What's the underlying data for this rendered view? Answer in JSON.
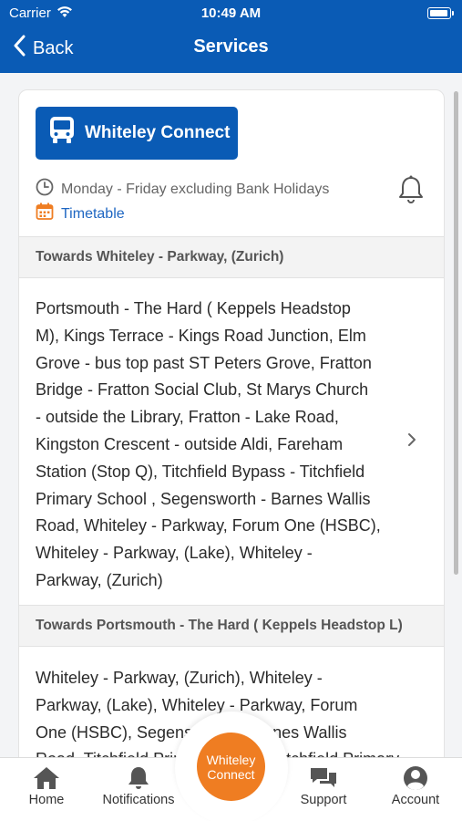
{
  "status_bar": {
    "carrier": "Carrier",
    "time": "10:49 AM"
  },
  "nav": {
    "back_label": "Back",
    "title": "Services"
  },
  "service": {
    "route_name": "Whiteley Connect",
    "schedule": "Monday - Friday excluding Bank Holidays",
    "timetable_label": "Timetable"
  },
  "directions": [
    {
      "heading": "Towards Whiteley - Parkway, (Zurich)",
      "stops_lines": [
        "Portsmouth - The Hard ( Keppels Headstop",
        "M), Kings Terrace - Kings Road Junction, Elm",
        "Grove - bus top past ST Peters Grove, Fratton",
        "Bridge - Fratton Social Club, St Marys Church",
        "- outside the Library, Fratton - Lake Road,",
        "Kingston Crescent - outside Aldi, Fareham",
        "Station (Stop Q), Titchfield Bypass - Titchfield",
        "Primary School , Segensworth - Barnes Wallis",
        "Road, Whiteley - Parkway, Forum One (HSBC),",
        "Whiteley - Parkway, (Lake), Whiteley -",
        "Parkway, (Zurich)"
      ]
    },
    {
      "heading": "Towards Portsmouth - The Hard ( Keppels Headstop L)",
      "stops_lines": [
        "Whiteley - Parkway, (Zurich), Whiteley -",
        "Parkway, (Lake), Whiteley - Parkway, Forum",
        "One (HSBC), Segensworth - Barnes Wallis",
        "Road, Titchfield Primary School, Titchfield Primary"
      ]
    }
  ],
  "tabbar": {
    "home": "Home",
    "notifications": "Notifications",
    "center_line1": "Whiteley",
    "center_line2": "Connect",
    "support": "Support",
    "account": "Account"
  },
  "colors": {
    "brand_blue": "#0a5bb5",
    "accent_orange": "#ef7d22",
    "link_blue": "#1e66c2"
  },
  "icons": [
    "wifi-icon",
    "battery-icon",
    "back-chevron-icon",
    "bus-icon",
    "clock-icon",
    "calendar-icon",
    "bell-icon",
    "chevron-right-icon",
    "home-icon",
    "notification-bell-icon",
    "support-chat-icon",
    "account-icon"
  ]
}
